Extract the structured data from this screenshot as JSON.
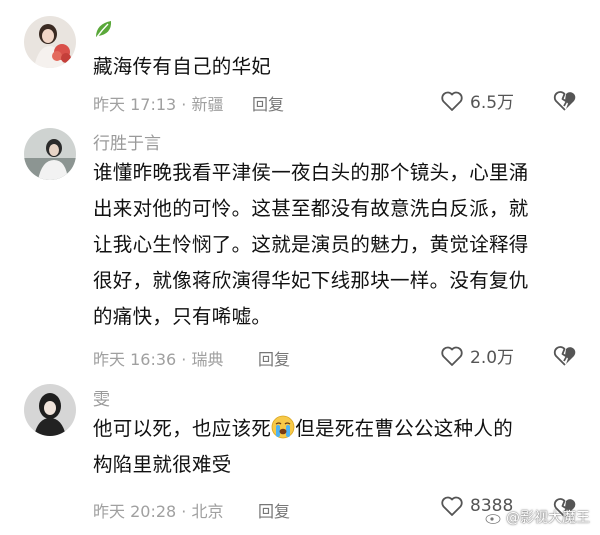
{
  "comments": [
    {
      "username": "",
      "badge_icon": "leaf-icon",
      "text": "藏海传有自己的华妃",
      "time": "昨天 17:13",
      "location": "新疆",
      "reply_label": "回复",
      "likes": "6.5万"
    },
    {
      "username": "行胜于言",
      "lines": [
        "谁懂昨晚我看平津侯一夜白头的那个镜头，心里涌",
        "出来对他的可怜。这甚至都没有故意洗白反派，就",
        "让我心生怜悯了。这就是演员的魅力，黄觉诠释得",
        "很好，就像蒋欣演得华妃下线那块一样。没有复仇",
        "的痛快，只有唏嘘。"
      ],
      "time": "昨天 16:36",
      "location": "瑞典",
      "reply_label": "回复",
      "likes": "2.0万"
    },
    {
      "username": "雯",
      "line1_a": "他可以死，也应该死",
      "emoji": "crying-face-icon",
      "line1_b": "但是死在曹公公这种人的",
      "line2": "构陷里就很难受",
      "time": "昨天 20:28",
      "location": "北京",
      "reply_label": "回复",
      "likes": "8388"
    }
  ],
  "separator": "·",
  "watermark": "@影视大魔王",
  "colors": {
    "text": "#111111",
    "meta": "#a0a0a0",
    "icon": "#555555"
  }
}
